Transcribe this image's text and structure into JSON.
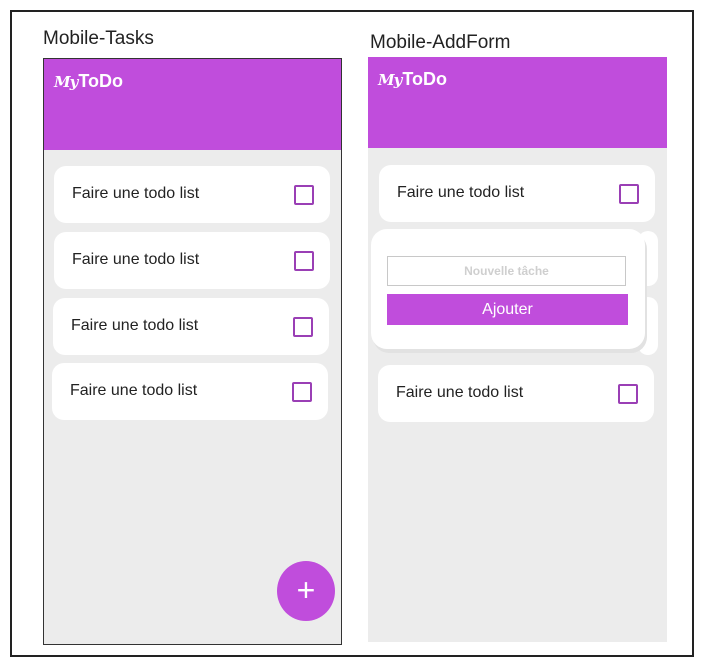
{
  "screens": [
    {
      "title": "Mobile-Tasks",
      "logo_prefix": "My",
      "logo_main": "ToDo",
      "tasks": [
        {
          "label": "Faire une todo list",
          "checked": false
        },
        {
          "label": "Faire une todo list",
          "checked": false
        },
        {
          "label": "Faire une todo list",
          "checked": false
        },
        {
          "label": "Faire une todo list",
          "checked": false
        }
      ],
      "fab_label": "+"
    },
    {
      "title": "Mobile-AddForm",
      "logo_prefix": "My",
      "logo_main": "ToDo",
      "tasks": [
        {
          "label": "Faire une todo list",
          "checked": false
        },
        {
          "label": "Faire une todo list",
          "checked": false
        }
      ],
      "form": {
        "placeholder": "Nouvelle tâche",
        "submit_label": "Ajouter"
      }
    }
  ],
  "colors": {
    "accent": "#c04ddc",
    "background": "#ececec",
    "card": "#ffffff",
    "checkbox_border": "#9a3fb5"
  }
}
